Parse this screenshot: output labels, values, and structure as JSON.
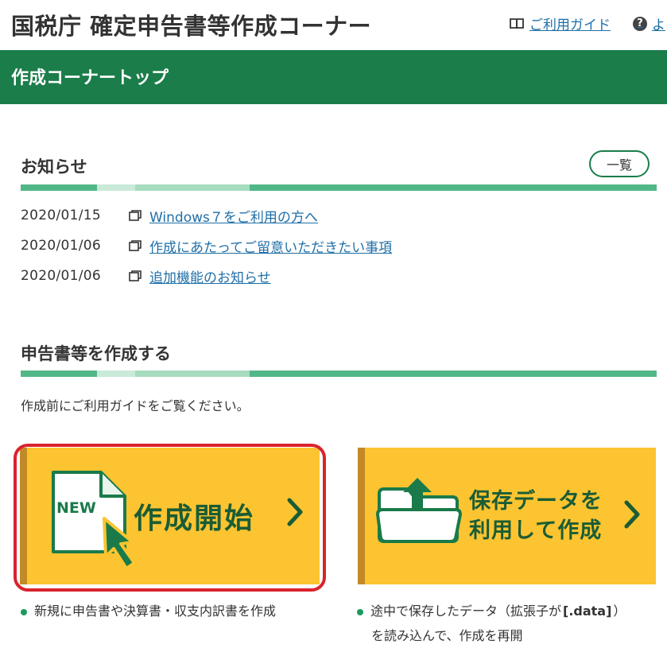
{
  "header": {
    "site_title": "国税庁 確定申告書等作成コーナー",
    "guide_link": "ご利用ガイド",
    "help_link": "よ"
  },
  "top_bar": {
    "title": "作成コーナートップ"
  },
  "notices": {
    "heading": "お知らせ",
    "list_button": "一覧",
    "items": [
      {
        "date": "2020/01/15",
        "title": "Windows７をご利用の方へ"
      },
      {
        "date": "2020/01/06",
        "title": "作成にあたってご留意いただきたい事項"
      },
      {
        "date": "2020/01/06",
        "title": "追加機能のお知らせ"
      }
    ]
  },
  "create": {
    "heading": "申告書等を作成する",
    "description": "作成前にご利用ガイドをご覧ください。",
    "start_button": {
      "badge": "NEW",
      "label": "作成開始"
    },
    "resume_button": {
      "line1": "保存データを",
      "line2": "利用して作成"
    },
    "start_note": "新規に申告書や決算書・収支内訳書を作成",
    "resume_note_line1_pre": "途中で保存したデータ（拡張子が",
    "resume_note_ext": "[.data]",
    "resume_note_line1_post": "）",
    "resume_note_line2": "を読み込んで、作成を再開"
  },
  "colors": {
    "brand_green": "#1b7d4a",
    "button_yellow": "#fbc430",
    "highlight_red": "#d9232d",
    "link_blue": "#1f6fa8"
  },
  "icons": [
    "book-icon",
    "help-icon",
    "window-icon",
    "new-file-icon",
    "folder-upload-icon",
    "chevron-right-icon"
  ]
}
